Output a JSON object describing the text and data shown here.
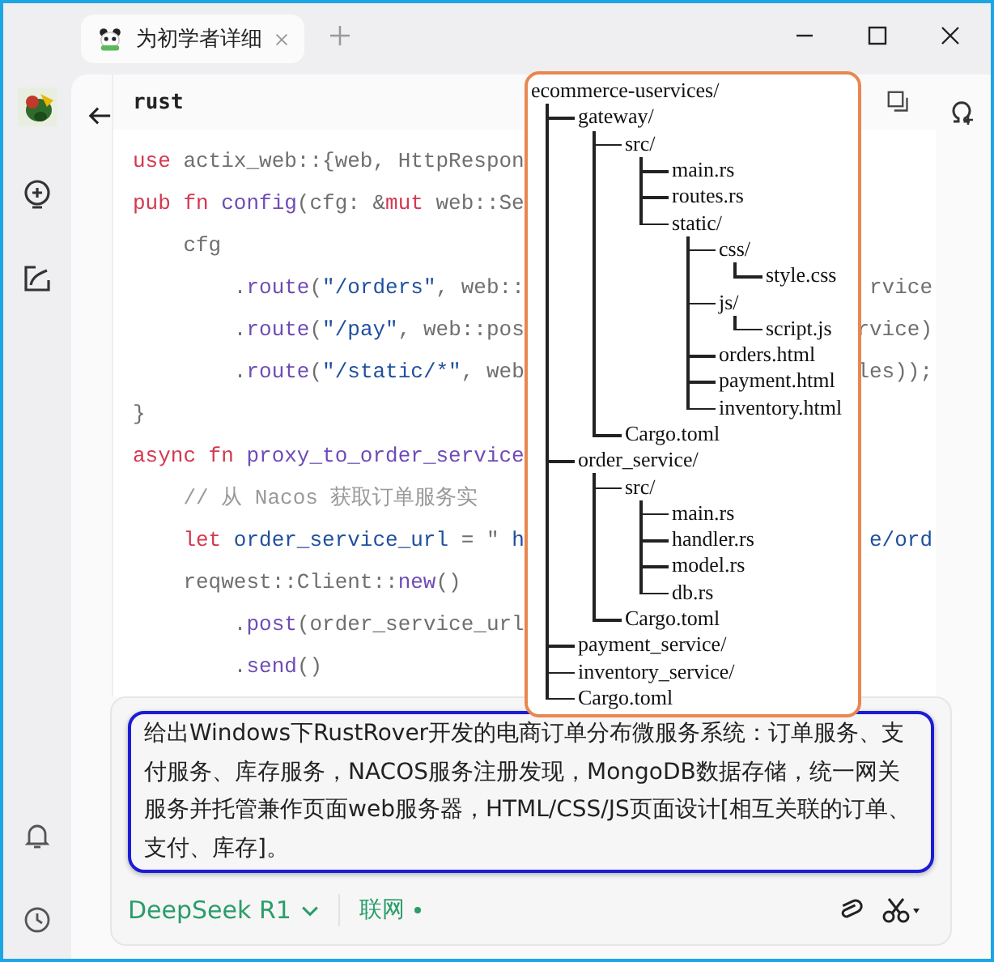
{
  "tab": {
    "title": "为初学者详细"
  },
  "code_block": {
    "language": "rust",
    "lines": [
      {
        "segments": [
          {
            "kind": "kw",
            "text": "use"
          },
          {
            "kind": "plain",
            "text": " actix_web::{web, HttpRespon"
          }
        ]
      },
      {
        "segments": [
          {
            "kind": "kw",
            "text": "pub fn"
          },
          {
            "kind": "fn",
            "text": " config"
          },
          {
            "kind": "plain",
            "text": "(cfg: &"
          },
          {
            "kind": "kw",
            "text": "mut"
          },
          {
            "kind": "plain",
            "text": " web::Se"
          }
        ]
      },
      {
        "segments": [
          {
            "kind": "plain",
            "text": "    cfg"
          }
        ]
      },
      {
        "segments": [
          {
            "kind": "plain",
            "text": "        ."
          },
          {
            "kind": "fn",
            "text": "route"
          },
          {
            "kind": "plain",
            "text": "("
          },
          {
            "kind": "str",
            "text": "\"/orders\""
          },
          {
            "kind": "plain",
            "text": ", web::"
          }
        ],
        "tail": [
          {
            "kind": "plain",
            "text": "rvice"
          }
        ]
      },
      {
        "segments": [
          {
            "kind": "plain",
            "text": "        ."
          },
          {
            "kind": "fn",
            "text": "route"
          },
          {
            "kind": "plain",
            "text": "("
          },
          {
            "kind": "str",
            "text": "\"/pay\""
          },
          {
            "kind": "plain",
            "text": ", web::pos"
          }
        ],
        "tail": [
          {
            "kind": "plain",
            "text": "rvice)"
          }
        ]
      },
      {
        "segments": [
          {
            "kind": "plain",
            "text": "        ."
          },
          {
            "kind": "fn",
            "text": "route"
          },
          {
            "kind": "plain",
            "text": "("
          },
          {
            "kind": "str",
            "text": "\"/static/*\""
          },
          {
            "kind": "plain",
            "text": ", web"
          }
        ],
        "tail": [
          {
            "kind": "plain",
            "text": "les));"
          }
        ]
      },
      {
        "segments": [
          {
            "kind": "plain",
            "text": "}"
          }
        ]
      },
      {
        "segments": [
          {
            "kind": "kw",
            "text": "async fn"
          },
          {
            "kind": "fn",
            "text": " proxy_to_order_service"
          }
        ]
      },
      {
        "segments": [
          {
            "kind": "comment",
            "text": "    // 从 Nacos 获取订单服务实"
          }
        ]
      },
      {
        "segments": [
          {
            "kind": "kw",
            "text": "    let"
          },
          {
            "kind": "str",
            "text": " order_service_url"
          },
          {
            "kind": "plain",
            "text": " = \" "
          },
          {
            "kind": "str",
            "text": "h"
          }
        ],
        "tail": [
          {
            "kind": "str",
            "text": "e/ord"
          }
        ]
      },
      {
        "segments": [
          {
            "kind": "plain",
            "text": "    reqwest::Client::"
          },
          {
            "kind": "fn",
            "text": "new"
          },
          {
            "kind": "plain",
            "text": "()"
          }
        ]
      },
      {
        "segments": [
          {
            "kind": "plain",
            "text": "        ."
          },
          {
            "kind": "fn",
            "text": "post"
          },
          {
            "kind": "plain",
            "text": "(order_service_url"
          }
        ]
      },
      {
        "segments": [
          {
            "kind": "plain",
            "text": "        ."
          },
          {
            "kind": "fn",
            "text": "send"
          },
          {
            "kind": "plain",
            "text": "()"
          }
        ]
      }
    ]
  },
  "file_tree": {
    "name": "ecommerce-uservices/",
    "children": [
      {
        "name": "gateway/",
        "children": [
          {
            "name": "src/",
            "children": [
              {
                "name": "main.rs"
              },
              {
                "name": "routes.rs"
              },
              {
                "name": "static/",
                "children": [
                  {
                    "name": "css/",
                    "children": [
                      {
                        "name": "style.css"
                      }
                    ]
                  },
                  {
                    "name": "js/",
                    "children": [
                      {
                        "name": "script.js"
                      }
                    ]
                  },
                  {
                    "name": "orders.html"
                  },
                  {
                    "name": "payment.html"
                  },
                  {
                    "name": "inventory.html"
                  }
                ]
              }
            ]
          },
          {
            "name": "Cargo.toml"
          }
        ]
      },
      {
        "name": "order_service/",
        "children": [
          {
            "name": "src/",
            "children": [
              {
                "name": "main.rs"
              },
              {
                "name": "handler.rs"
              },
              {
                "name": "model.rs"
              },
              {
                "name": "db.rs"
              }
            ]
          },
          {
            "name": "Cargo.toml"
          }
        ]
      },
      {
        "name": "payment_service/"
      },
      {
        "name": "inventory_service/"
      },
      {
        "name": "Cargo.toml"
      }
    ]
  },
  "composer": {
    "text": "给出Windows下RustRover开发的电商订单分布微服务系统：订单服务、支付服务、库存服务，NACOS服务注册发现，MongoDB数据存储，统一网关服务并托管兼作页面web服务器，HTML/CSS/JS页面设计[相互关联的订单、支付、库存]。",
    "model": "DeepSeek R1",
    "web_search": "联网"
  }
}
